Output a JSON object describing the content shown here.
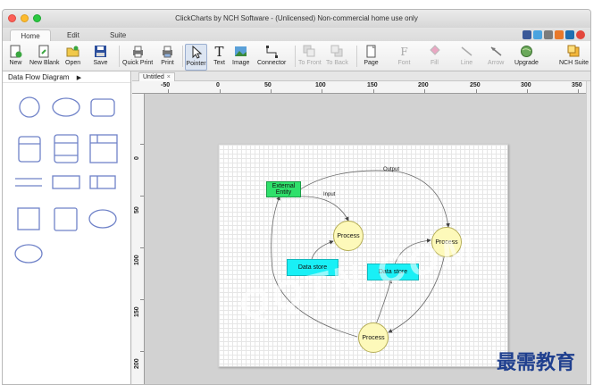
{
  "window": {
    "title": "ClickCharts by NCH Software - (Unlicensed) Non-commercial home use only"
  },
  "tabs": [
    {
      "label": "Home",
      "active": true
    },
    {
      "label": "Edit",
      "active": false
    },
    {
      "label": "Suite",
      "active": false
    }
  ],
  "social_icons": [
    "facebook-icon",
    "twitter-icon",
    "blogger-icon",
    "share-icon",
    "linkedin-icon",
    "help-icon"
  ],
  "toolbar": {
    "new": "New",
    "new_blank": "New Blank",
    "open": "Open",
    "save": "Save",
    "quick_print": "Quick Print",
    "print": "Print",
    "pointer": "Pointer",
    "text": "Text",
    "image": "Image",
    "connector": "Connector",
    "to_front": "To Front",
    "to_back": "To Back",
    "page": "Page",
    "font": "Font",
    "fill": "Fill",
    "line": "Line",
    "arrow": "Arrow",
    "upgrade": "Upgrade",
    "nch_suite": "NCH Suite"
  },
  "sidebar": {
    "title": "Data Flow Diagram",
    "shapes": [
      "circle",
      "ellipse",
      "rounded-rectangle",
      "rectangle-header",
      "process-box",
      "split-box",
      "line",
      "rectangle",
      "split-rectangle",
      "square",
      "rounded-square",
      "ellipse",
      "ellipse"
    ]
  },
  "document": {
    "tab_label": "Untitled",
    "close_glyph": "×"
  },
  "ruler": {
    "horizontal": [
      "-50",
      "0",
      "50",
      "100",
      "150",
      "200",
      "250",
      "300",
      "350"
    ],
    "vertical": [
      "0",
      "50",
      "100",
      "150",
      "200"
    ]
  },
  "diagram": {
    "external_entity": "External Entity",
    "process_1": "Process",
    "process_2": "Process",
    "process_3": "Process",
    "data_store_1": "Data store",
    "data_store_2": "Data store",
    "label_output": "Output",
    "label_input": "Input"
  },
  "colors": {
    "entity": "#2fe06b",
    "data_store": "#19f0f6",
    "process": "#fdf9ba",
    "selected_tool": "#dce5f2"
  },
  "watermark": "QQTN.COM",
  "brand_text": "最需教育"
}
